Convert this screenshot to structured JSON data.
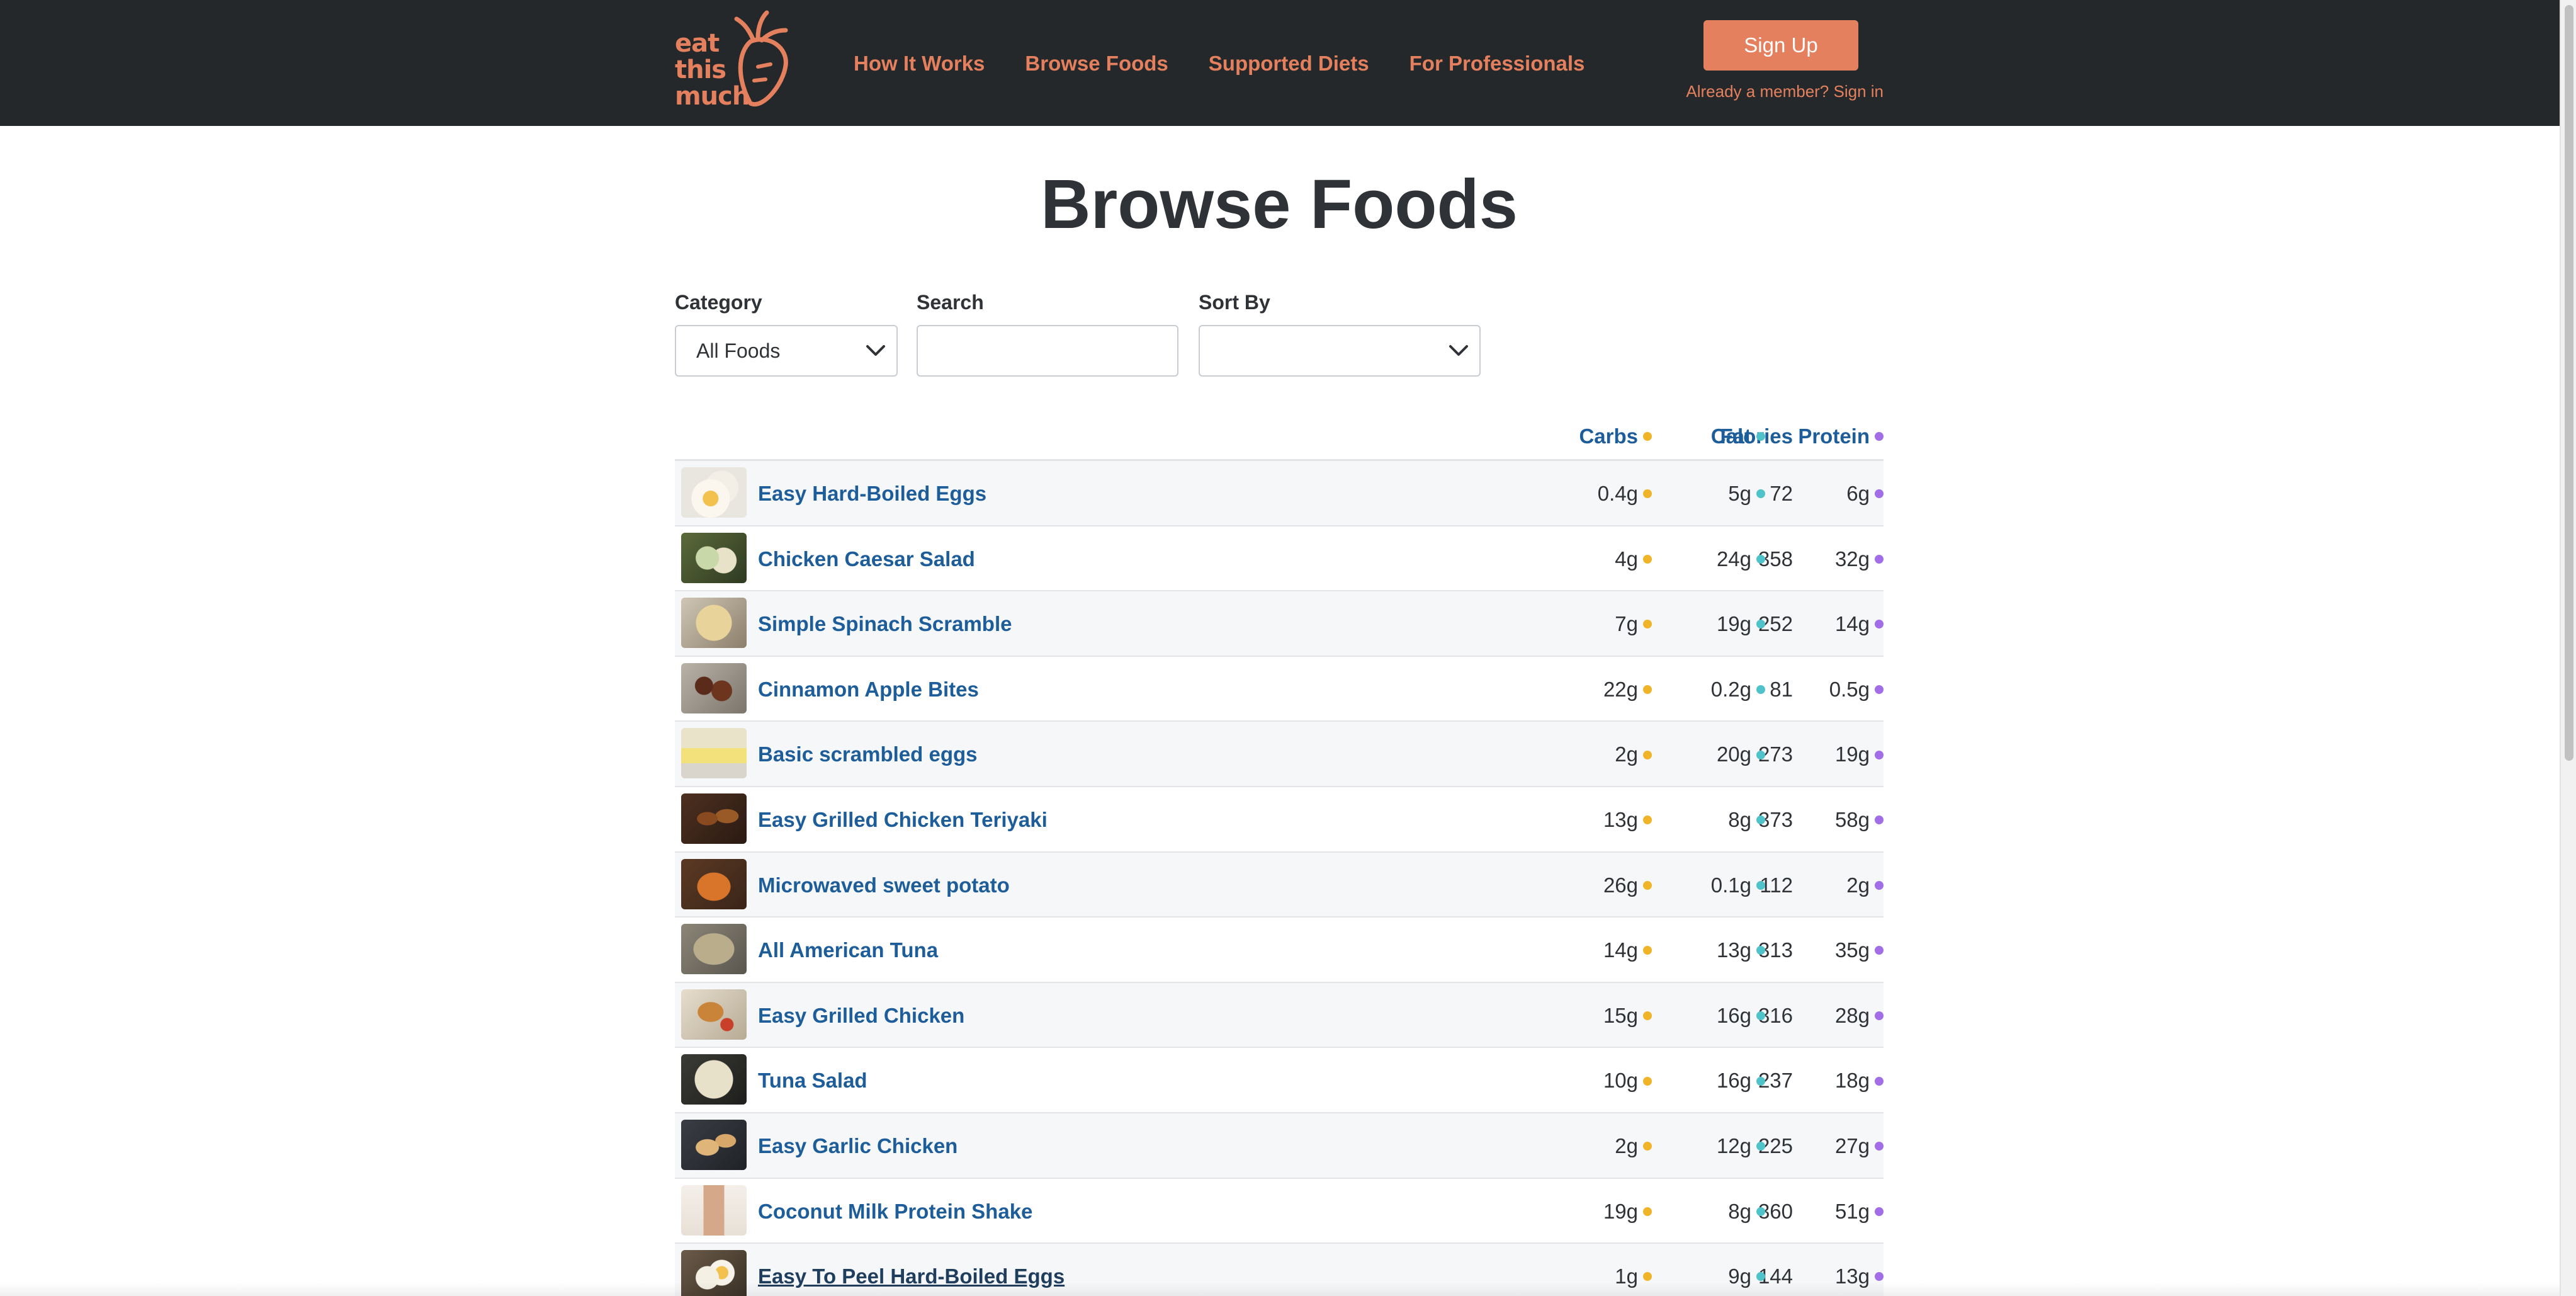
{
  "colors": {
    "topbar": "#25282b",
    "accent": "#e4805d",
    "link": "#1d5d99",
    "carbs_dot": "#f0b429",
    "fat_dot": "#4fc3c9",
    "protein_dot": "#a26ee8"
  },
  "header": {
    "logo_text": "eat\nthis\nmuch",
    "nav": [
      "How It Works",
      "Browse Foods",
      "Supported Diets",
      "For Professionals"
    ],
    "signup_label": "Sign Up",
    "signin_text": "Already a member? Sign in"
  },
  "page_title": "Browse Foods",
  "filters": {
    "category_label": "Category",
    "category_value": "All Foods",
    "search_label": "Search",
    "search_value": "",
    "sort_label": "Sort By",
    "sort_value": ""
  },
  "table": {
    "columns": {
      "calories": "Calories",
      "carbs": "Carbs",
      "fat": "Fat",
      "protein": "Protein"
    },
    "rows": [
      {
        "name": "Easy Hard-Boiled Eggs",
        "calories": "72",
        "carbs": "0.4g",
        "fat": "5g",
        "protein": "6g",
        "thumb": "egg"
      },
      {
        "name": "Chicken Caesar Salad",
        "calories": "358",
        "carbs": "4g",
        "fat": "24g",
        "protein": "32g",
        "thumb": "salad"
      },
      {
        "name": "Simple Spinach Scramble",
        "calories": "252",
        "carbs": "7g",
        "fat": "19g",
        "protein": "14g",
        "thumb": "scramble"
      },
      {
        "name": "Cinnamon Apple Bites",
        "calories": "81",
        "carbs": "22g",
        "fat": "0.2g",
        "protein": "0.5g",
        "thumb": "apple"
      },
      {
        "name": "Basic scrambled eggs",
        "calories": "273",
        "carbs": "2g",
        "fat": "20g",
        "protein": "19g",
        "thumb": "eggs"
      },
      {
        "name": "Easy Grilled Chicken Teriyaki",
        "calories": "373",
        "carbs": "13g",
        "fat": "8g",
        "protein": "58g",
        "thumb": "teriyaki"
      },
      {
        "name": "Microwaved sweet potato",
        "calories": "112",
        "carbs": "26g",
        "fat": "0.1g",
        "protein": "2g",
        "thumb": "potato"
      },
      {
        "name": "All American Tuna",
        "calories": "313",
        "carbs": "14g",
        "fat": "13g",
        "protein": "35g",
        "thumb": "tuna"
      },
      {
        "name": "Easy Grilled Chicken",
        "calories": "316",
        "carbs": "15g",
        "fat": "16g",
        "protein": "28g",
        "thumb": "chicken"
      },
      {
        "name": "Tuna Salad",
        "calories": "237",
        "carbs": "10g",
        "fat": "16g",
        "protein": "18g",
        "thumb": "tunasalad"
      },
      {
        "name": "Easy Garlic Chicken",
        "calories": "225",
        "carbs": "2g",
        "fat": "12g",
        "protein": "27g",
        "thumb": "garlic"
      },
      {
        "name": "Coconut Milk Protein Shake",
        "calories": "360",
        "carbs": "19g",
        "fat": "8g",
        "protein": "51g",
        "thumb": "shake"
      },
      {
        "name": "Easy To Peel Hard-Boiled Eggs",
        "calories": "144",
        "carbs": "1g",
        "fat": "9g",
        "protein": "13g",
        "thumb": "peeled",
        "hovered": true
      }
    ]
  }
}
